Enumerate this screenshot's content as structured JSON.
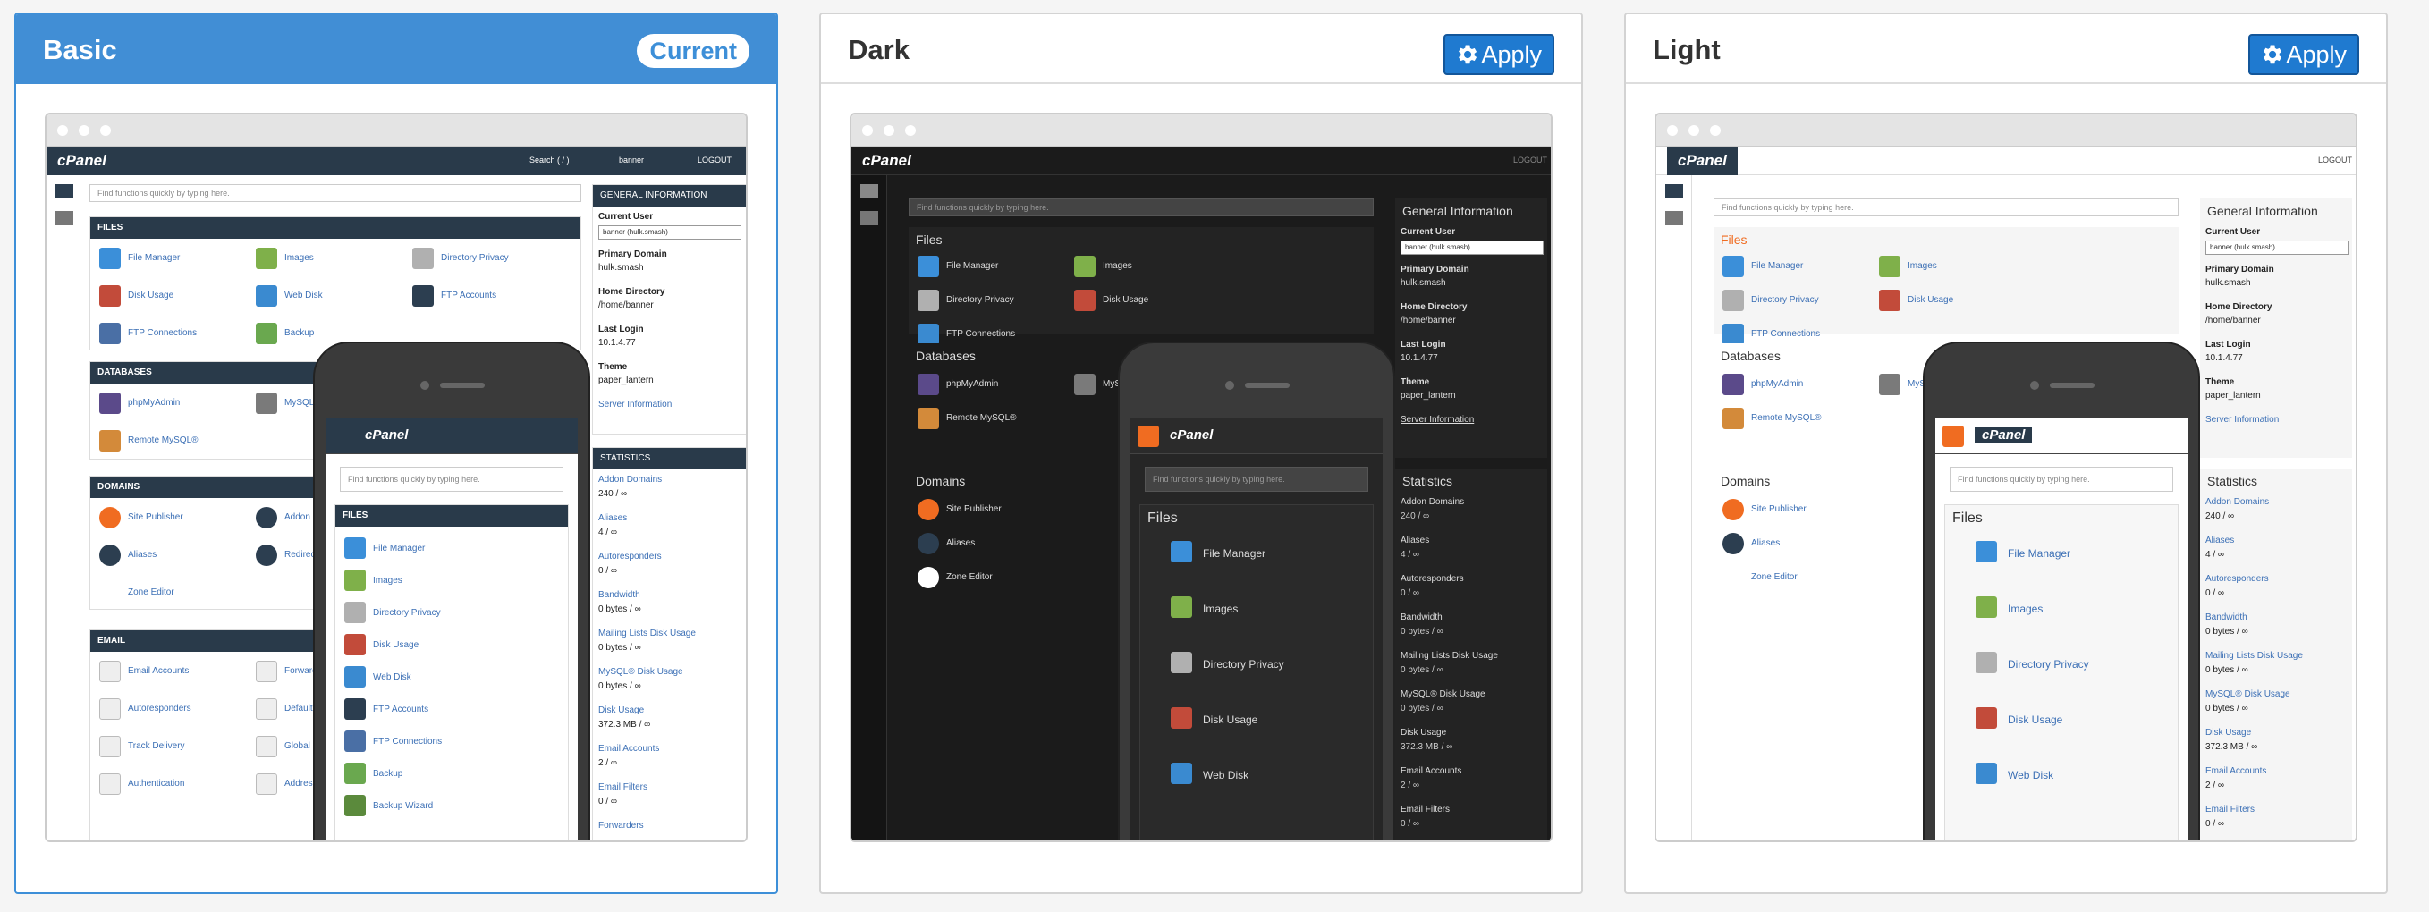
{
  "themes": [
    {
      "id": "basic",
      "title": "Basic",
      "status": "Current",
      "is_current": true
    },
    {
      "id": "dark",
      "title": "Dark",
      "status": "Apply",
      "is_current": false
    },
    {
      "id": "light",
      "title": "Light",
      "status": "Apply",
      "is_current": false
    }
  ],
  "icons": {
    "apply": "gear-icon",
    "grid": "grid-icon",
    "users": "users-icon",
    "search": "search-icon",
    "bell": "bell-icon",
    "user": "user-icon",
    "logout": "logout-icon",
    "menu": "hamburger-icon"
  },
  "colors": {
    "accent": "#418ed5",
    "apply_button": "#1f7ad0",
    "basic_header": "#293a4a",
    "dark_bg": "#1b1b1b",
    "light_bg": "#ffffff",
    "orange": "#f06c21"
  },
  "preview": {
    "logo": "cPanel",
    "search_label": "Search ( / )",
    "user_menu": "banner",
    "logout": "LOGOUT",
    "search_placeholder": "Find functions quickly by typing here.",
    "files": "FILES",
    "databases": "DATABASES",
    "domains": "DOMAINS",
    "email": "EMAIL",
    "files_title": "Files",
    "databases_title": "Databases",
    "domains_title": "Domains",
    "file_items": [
      "File Manager",
      "Images",
      "Directory Privacy",
      "Disk Usage",
      "Web Disk",
      "FTP Accounts",
      "FTP Connections",
      "Backup",
      "Backup Wizard"
    ],
    "database_items": [
      "phpMyAdmin",
      "MySQL",
      "Remote MySQL®"
    ],
    "domain_items": [
      "Site Publisher",
      "Addon",
      "Aliases",
      "Redirects",
      "Zone Editor"
    ],
    "email_items": [
      "Email Accounts",
      "Forwarders",
      "Autoresponders",
      "Default",
      "Track Delivery",
      "Global",
      "Authentication",
      "Address"
    ],
    "gi": {
      "heading": "GENERAL INFORMATION",
      "heading_title": "General Information",
      "current_user": "Current User",
      "current_user_value": "banner (hulk.smash)",
      "primary_domain": "Primary Domain",
      "primary_domain_value": "hulk.smash",
      "home_directory": "Home Directory",
      "home_directory_value": "/home/banner",
      "last_login": "Last Login",
      "last_login_value": "10.1.4.77",
      "theme": "Theme",
      "theme_value": "paper_lantern",
      "server_info": "Server Information"
    },
    "stats": {
      "heading": "STATISTICS",
      "heading_title": "Statistics",
      "items": [
        {
          "label": "Addon Domains",
          "value": "240 / ∞"
        },
        {
          "label": "Aliases",
          "value": "4 / ∞"
        },
        {
          "label": "Autoresponders",
          "value": "0 / ∞"
        },
        {
          "label": "Bandwidth",
          "value": "0 bytes / ∞"
        },
        {
          "label": "Mailing Lists Disk Usage",
          "value": "0 bytes / ∞"
        },
        {
          "label": "MySQL® Disk Usage",
          "value": "0 bytes / ∞"
        },
        {
          "label": "Disk Usage",
          "value": "372.3 MB / ∞"
        },
        {
          "label": "Email Accounts",
          "value": "2 / ∞"
        },
        {
          "label": "Email Filters",
          "value": "0 / ∞"
        },
        {
          "label": "Forwarders",
          "value": ""
        }
      ]
    },
    "mobile_search_placeholder": "Find functions quickly by typing here."
  }
}
